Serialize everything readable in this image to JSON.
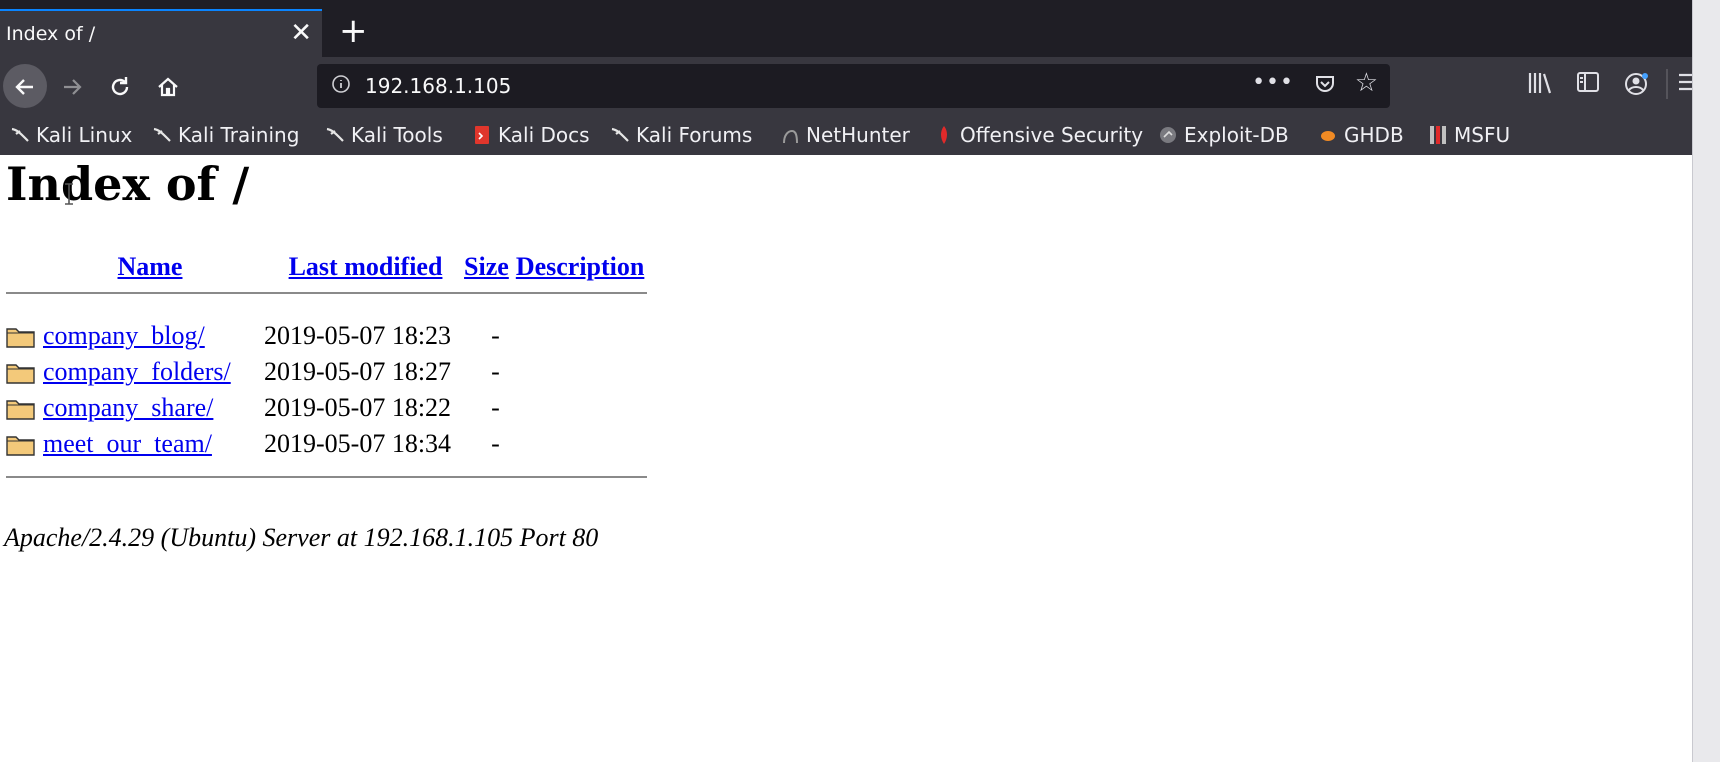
{
  "browser": {
    "tab_title": "Index of /",
    "tab_close": "✕",
    "new_tab": "+",
    "url": "192.168.1.105",
    "url_more": "•••",
    "bookmarks": [
      {
        "label": "Kali Linux",
        "icon": "kali-dragon-icon"
      },
      {
        "label": "Kali Training",
        "icon": "kali-dragon-icon"
      },
      {
        "label": "Kali Tools",
        "icon": "kali-dragon-icon"
      },
      {
        "label": "Kali Docs",
        "icon": "kali-docs-icon"
      },
      {
        "label": "Kali Forums",
        "icon": "kali-dragon-icon"
      },
      {
        "label": "NetHunter",
        "icon": "nethunter-icon"
      },
      {
        "label": "Offensive Security",
        "icon": "offsec-icon"
      },
      {
        "label": "Exploit-DB",
        "icon": "exploitdb-icon"
      },
      {
        "label": "GHDB",
        "icon": "ghdb-icon"
      },
      {
        "label": "MSFU",
        "icon": "msfu-icon"
      }
    ]
  },
  "page": {
    "heading": "Index of /",
    "columns": {
      "name": "Name",
      "modified": "Last modified",
      "size": "Size",
      "description": "Description"
    },
    "entries": [
      {
        "name": "company_blog/",
        "modified": "2019-05-07 18:23",
        "size": "-",
        "icon": "folder-icon"
      },
      {
        "name": "company_folders/",
        "modified": "2019-05-07 18:27",
        "size": "-",
        "icon": "folder-icon"
      },
      {
        "name": "company_share/",
        "modified": "2019-05-07 18:22",
        "size": "-",
        "icon": "folder-icon"
      },
      {
        "name": "meet_our_team/",
        "modified": "2019-05-07 18:34",
        "size": "-",
        "icon": "folder-icon"
      }
    ],
    "footer": "Apache/2.4.29 (Ubuntu) Server at 192.168.1.105 Port 80"
  },
  "colors": {
    "link": "#0000ee",
    "chrome_dark": "#1f1e25",
    "chrome": "#38373f",
    "accent": "#0a84ff"
  }
}
